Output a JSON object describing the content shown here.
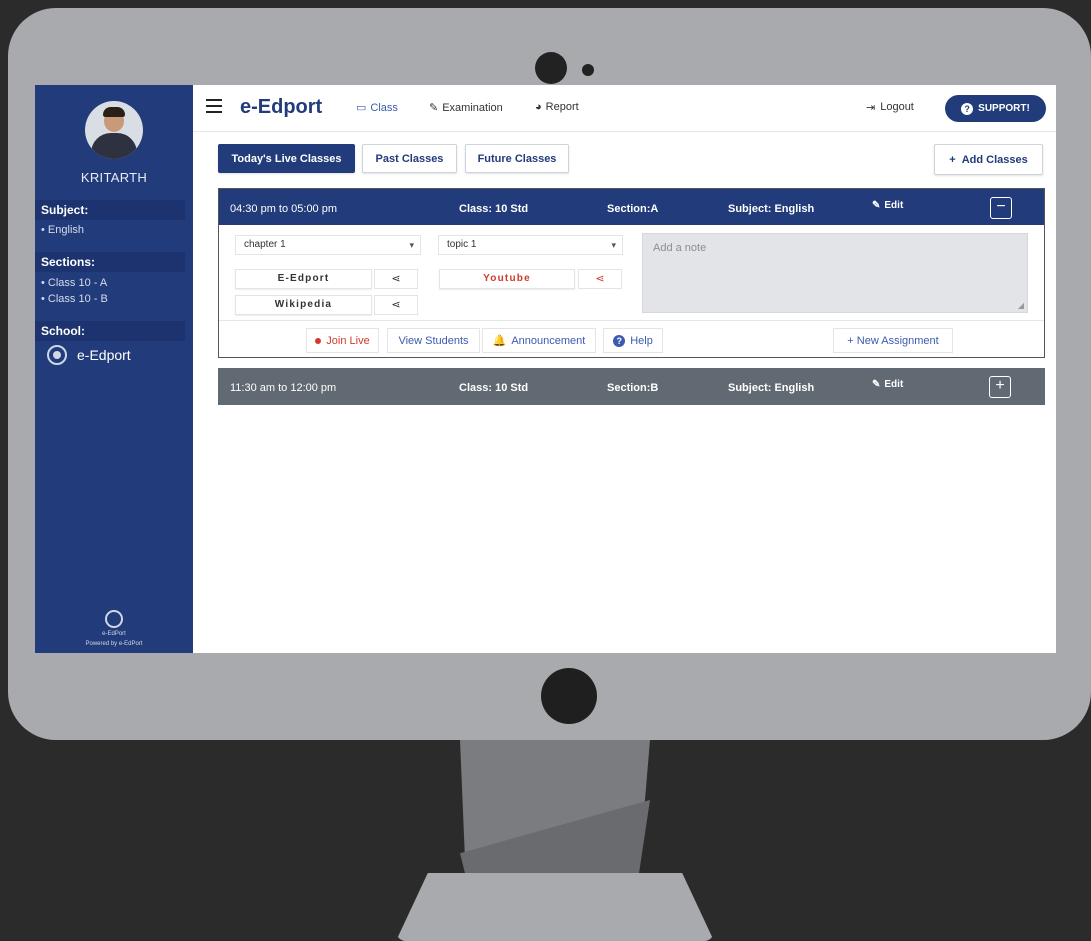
{
  "user": {
    "name": "KRITARTH"
  },
  "sidebar": {
    "subject_heading": "Subject:",
    "subjects": [
      "English"
    ],
    "sections_heading": "Sections:",
    "sections": [
      "Class 10 - A",
      "Class 10 - B"
    ],
    "school_heading": "School:",
    "school_name": "e-Edport",
    "footer_brand": "e-EdPort",
    "footer_powered": "Powered by e-EdPort"
  },
  "topbar": {
    "brand": "e-Edport",
    "nav": [
      {
        "label": "Class",
        "icon": "monitor-icon"
      },
      {
        "label": "Examination",
        "icon": "edit-icon"
      },
      {
        "label": "Report",
        "icon": "pie-chart-icon"
      }
    ],
    "logout": "Logout",
    "support": "SUPPORT!"
  },
  "tabs": [
    "Today's Live Classes",
    "Past Classes",
    "Future Classes"
  ],
  "active_tab": "Today's Live Classes",
  "add_classes": "Add Classes",
  "classes": [
    {
      "time": "04:30 pm to 05:00 pm",
      "class": "Class: 10 Std",
      "section": "Section:A",
      "subject": "Subject: English",
      "edit": "Edit",
      "toggle": "−",
      "chapter": "chapter 1",
      "topic": "topic 1",
      "resources": [
        "E-Edport",
        "Wikipedia",
        "Youtube"
      ],
      "note_placeholder": "Add a note",
      "actions": {
        "join": "Join Live",
        "students": "View Students",
        "announcement": "Announcement",
        "help": "Help",
        "new_assignment": "+ New Assignment"
      }
    },
    {
      "time": "11:30 am to 12:00 pm",
      "class": "Class: 10 Std",
      "section": "Section:B",
      "subject": "Subject: English",
      "edit": "Edit",
      "toggle": "+"
    }
  ],
  "colors": {
    "primary": "#223b7b",
    "collapsed_header": "#616a72",
    "accent_red": "#d23a2e",
    "link_blue": "#3b5bb0"
  }
}
